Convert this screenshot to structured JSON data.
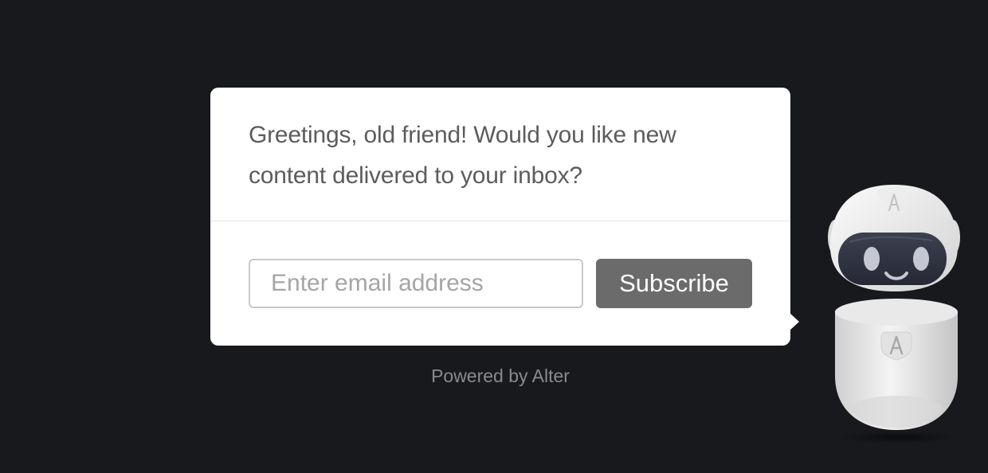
{
  "popup": {
    "message": "Greetings, old friend! Would you like new content delivered to your inbox?",
    "email_placeholder": "Enter email address",
    "email_value": "",
    "subscribe_label": "Subscribe"
  },
  "footer": {
    "powered_by": "Powered by Alter"
  },
  "mascot": {
    "icon": "robot-mascot-icon"
  },
  "colors": {
    "background": "#18191d",
    "card": "#ffffff",
    "text": "#5c5c5c",
    "button": "#6b6b6b",
    "button_text": "#ffffff",
    "input_border": "#c9c9c9",
    "footer_text": "#8a8a8a"
  }
}
